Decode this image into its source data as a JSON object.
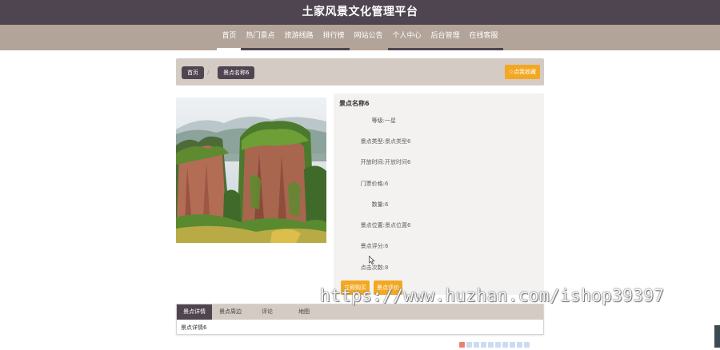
{
  "site": {
    "title": "土家风景文化管理平台"
  },
  "nav": [
    {
      "label": "首页",
      "active": true
    },
    {
      "label": "热门景点"
    },
    {
      "label": "旅游线路"
    },
    {
      "label": "排行榜"
    },
    {
      "label": "网站公告"
    },
    {
      "label": "个人中心"
    },
    {
      "label": "后台管理"
    },
    {
      "label": "在线客服"
    }
  ],
  "breadcrumb": {
    "home": "首页",
    "separator": "/",
    "current": "景点名称6"
  },
  "favorite_button": "☆点我收藏",
  "detail": {
    "title": "景点名称6",
    "fields": [
      {
        "label": "等级:",
        "value": "一星"
      },
      {
        "label": "景点类型:",
        "value": "景点类型6"
      },
      {
        "label": "开放时间:",
        "value": "开放时间6"
      },
      {
        "label": "门票价格:",
        "value": "6"
      },
      {
        "label": "数量:",
        "value": "6"
      },
      {
        "label": "景点位置:",
        "value": "景点位置6"
      },
      {
        "label": "景点评分:",
        "value": "6"
      },
      {
        "label": "点击次数:",
        "value": "8"
      }
    ],
    "buy_button": "立即购买",
    "review_button": "景点评价"
  },
  "tabs": [
    {
      "label": "景点详情",
      "active": true
    },
    {
      "label": "景点周边"
    },
    {
      "label": "评论"
    },
    {
      "label": "地图"
    }
  ],
  "tab_content": "景点详情6",
  "watermark": "https://www.huzhan.com/ishop39397",
  "colors": {
    "header": "#4f4550",
    "nav": "#b3a499",
    "accent": "#f3a823",
    "panel": "#f3f2f1"
  }
}
